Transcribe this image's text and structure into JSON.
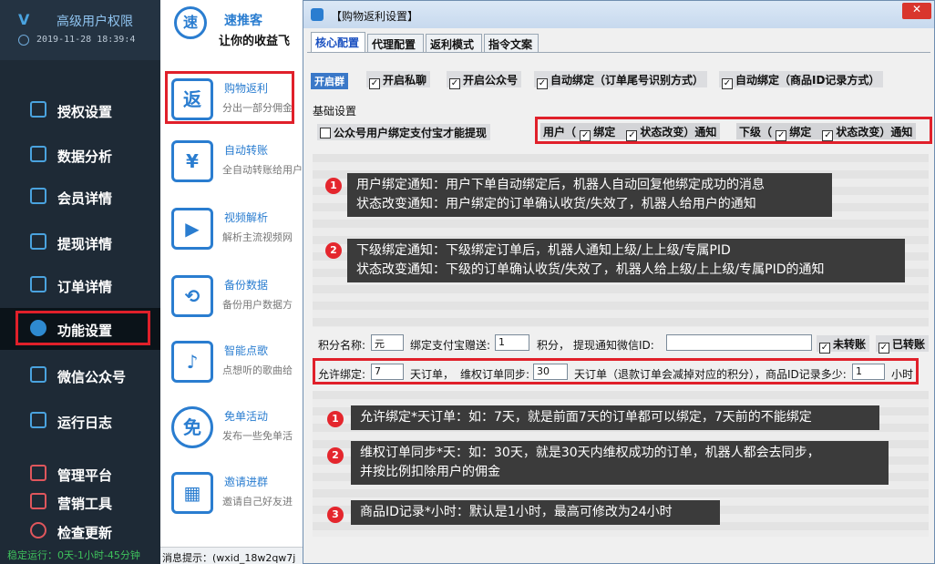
{
  "sidebar": {
    "app_title": "高级用户权限",
    "datetime": "2019-11-28 18:39:4",
    "items": [
      {
        "label": "授权设置"
      },
      {
        "label": "数据分析"
      },
      {
        "label": "会员详情"
      },
      {
        "label": "提现详情"
      },
      {
        "label": "订单详情"
      },
      {
        "label": "功能设置"
      },
      {
        "label": "微信公众号"
      },
      {
        "label": "运行日志"
      },
      {
        "label": "管理平台"
      },
      {
        "label": "营销工具"
      },
      {
        "label": "检查更新"
      }
    ],
    "active_item": "功能设置",
    "status_text": "稳定运行：0天-1小时-45分钟"
  },
  "midpanel": {
    "brand_name": "速推客",
    "brand_slogan": "让你的收益飞",
    "features": [
      {
        "title": "购物返利",
        "desc": "分出一部分佣金",
        "icon": "返"
      },
      {
        "title": "自动转账",
        "desc": "全自动转账给用户",
        "icon": "¥"
      },
      {
        "title": "视频解析",
        "desc": "解析主流视频网",
        "icon": "▶"
      },
      {
        "title": "备份数据",
        "desc": "备份用户数据方",
        "icon": "⟲"
      },
      {
        "title": "智能点歌",
        "desc": "点想听的歌曲给",
        "icon": "♪"
      },
      {
        "title": "免单活动",
        "desc": "发布一些免单活",
        "icon": "免"
      },
      {
        "title": "邀请进群",
        "desc": "邀请自己好友进",
        "icon": "▦"
      }
    ],
    "hint_label": "消息提示：",
    "hint_value": "(wxid_18w2qw7j"
  },
  "dialog": {
    "title": "【购物返利设置】",
    "close_label": "✕",
    "tabs": [
      "核心配置",
      "代理配置",
      "返利模式",
      "指令文案"
    ],
    "active_tab": "核心配置",
    "group_label": "开启群",
    "top_checks": [
      {
        "label": "开启私聊",
        "checked": true
      },
      {
        "label": "开启公众号",
        "checked": true
      },
      {
        "label": "自动绑定（订单尾号识别方式）",
        "checked": true
      },
      {
        "label": "自动绑定（商品ID记录方式）",
        "checked": true
      }
    ],
    "section_label": "基础设置",
    "alipay_check": "公众号用户绑定支付宝才能提现",
    "user_notify": {
      "prefix": "用户（",
      "bind": "绑定",
      "state": "状态改变）通知"
    },
    "sub_notify": {
      "prefix": "下级（",
      "bind": "绑定",
      "state": "状态改变）通知"
    },
    "tips1": [
      {
        "num": "1",
        "lines": [
          "用户绑定通知：用户下单自动绑定后，机器人自动回复他绑定成功的消息",
          "状态改变通知：用户绑定的订单确认收货/失效了，机器人给用户的通知"
        ]
      },
      {
        "num": "2",
        "lines": [
          "下级绑定通知：下级绑定订单后，机器人通知上级/上上级/专属PID",
          "状态改变通知：下级的订单确认收货/失效了，机器人给上级/上上级/专属PID的通知"
        ]
      }
    ],
    "row1": {
      "points_name_label": "积分名称:",
      "points_name_value": "元",
      "bind_alipay_label": "绑定支付宝赠送:",
      "bind_alipay_value": "1",
      "points_unit": "积分，",
      "withdraw_notify_label": "提现通知微信ID:",
      "withdraw_notify_value": "",
      "not_transferred": "未转账",
      "transferred": "已转账"
    },
    "row2": {
      "allow_bind_label": "允许绑定:",
      "allow_bind_value": "7",
      "allow_bind_unit": "天订单，",
      "sync_label": "维权订单同步:",
      "sync_value": "30",
      "sync_unit": "天订单（退款订单会减掉对应的积分），商品ID记录多少:",
      "record_value": "1",
      "record_unit": "小时"
    },
    "tips2": [
      {
        "num": "1",
        "lines": [
          "允许绑定*天订单：如：7天，就是前面7天的订单都可以绑定，7天前的不能绑定"
        ]
      },
      {
        "num": "2",
        "lines": [
          "维权订单同步*天：如：30天，就是30天内维权成功的订单，机器人都会去同步，",
          "并按比例扣除用户的佣金"
        ]
      },
      {
        "num": "3",
        "lines": [
          "商品ID记录*小时：默认是1小时，最高可修改为24小时"
        ]
      }
    ]
  },
  "colors": {
    "accent": "#2a7dd0",
    "highlight": "#e0202a",
    "sidebar_bg": "#1e2a36"
  }
}
